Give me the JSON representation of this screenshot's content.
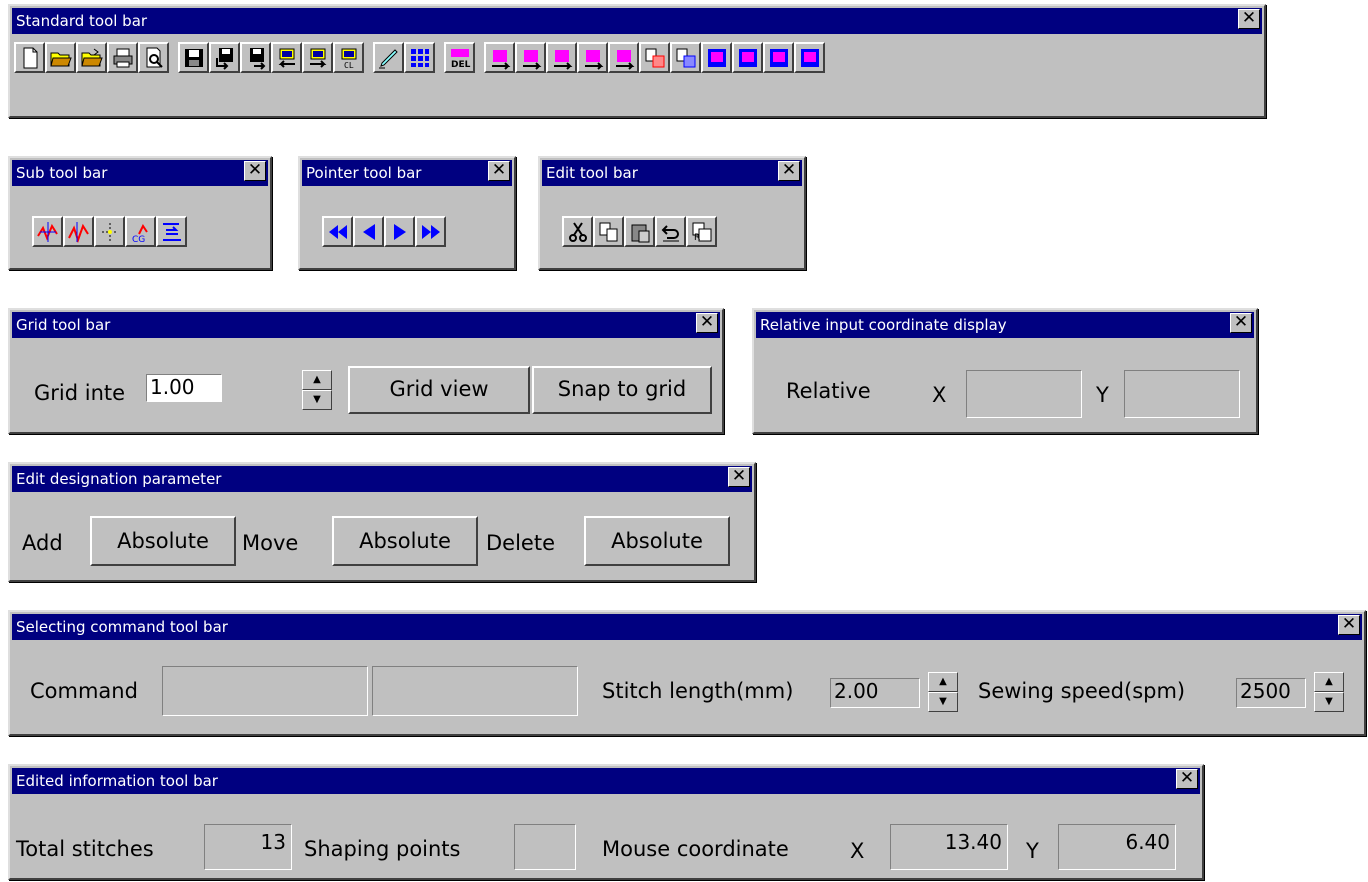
{
  "standard": {
    "title": "Standard tool bar",
    "close_label": "✕",
    "icons": [
      "new-file-icon",
      "open-folder-icon",
      "open-folder-alt-icon",
      "print-icon",
      "print-preview-icon",
      "save-icon",
      "save-down-icon",
      "save-up-icon",
      "chip-load-icon",
      "chip-save-icon",
      "chip-clear-icon",
      "pen-icon",
      "grid-pattern-icon",
      "delete-del-icon",
      "magenta-transform-1-icon",
      "magenta-transform-2-icon",
      "magenta-transform-3-icon",
      "magenta-transform-4-icon",
      "magenta-transform-5-icon",
      "register-icon",
      "register-alt-icon",
      "blue-window-1-icon",
      "blue-window-2-icon",
      "blue-window-3-icon",
      "blue-window-4-icon"
    ]
  },
  "sub": {
    "title": "Sub tool bar",
    "close_label": "✕",
    "icons": [
      "wave-tool-icon",
      "stitch-tool-icon",
      "point-tool-icon",
      "cg-tool-icon",
      "align-tool-icon"
    ]
  },
  "pointer": {
    "title": "Pointer tool bar",
    "close_label": "✕",
    "icons": [
      "rewind-icon",
      "back-icon",
      "forward-icon",
      "fast-forward-icon"
    ]
  },
  "edit": {
    "title": "Edit tool bar",
    "close_label": "✕",
    "icons": [
      "cut-icon",
      "copy-icon",
      "paste-icon",
      "undo-icon",
      "redo-icon"
    ]
  },
  "grid": {
    "title": "Grid tool bar",
    "label": "Grid inte",
    "value": "1.00",
    "view_button": "Grid view",
    "snap_button": "Snap to grid",
    "close_label": "✕"
  },
  "relative": {
    "title": "Relative input coordinate display",
    "label": "Relative",
    "x_label": "X",
    "y_label": "Y",
    "close_label": "✕"
  },
  "designation": {
    "title": "Edit designation parameter",
    "add_label": "Add",
    "add_value": "Absolute",
    "move_label": "Move",
    "move_value": "Absolute",
    "delete_label": "Delete",
    "delete_value": "Absolute",
    "close_label": "✕"
  },
  "command": {
    "title": "Selecting command tool bar",
    "command_label": "Command",
    "stitch_label": "Stitch length(mm)",
    "stitch_value": "2.00",
    "speed_label": "Sewing speed(spm)",
    "speed_value": "2500",
    "close_label": "✕"
  },
  "info": {
    "title": "Edited information tool bar",
    "total_label": "Total stitches",
    "total_value": "13",
    "shaping_label": "Shaping points",
    "shaping_value": "",
    "mouse_label": "Mouse coordinate",
    "x_label": "X",
    "x_value": "13.40",
    "y_label": "Y",
    "y_value": "6.40",
    "close_label": "✕"
  },
  "colors": {
    "title_bg": "#000080",
    "face": "#c0c0c0",
    "magenta": "#ff00ff",
    "blue": "#0000ff"
  }
}
